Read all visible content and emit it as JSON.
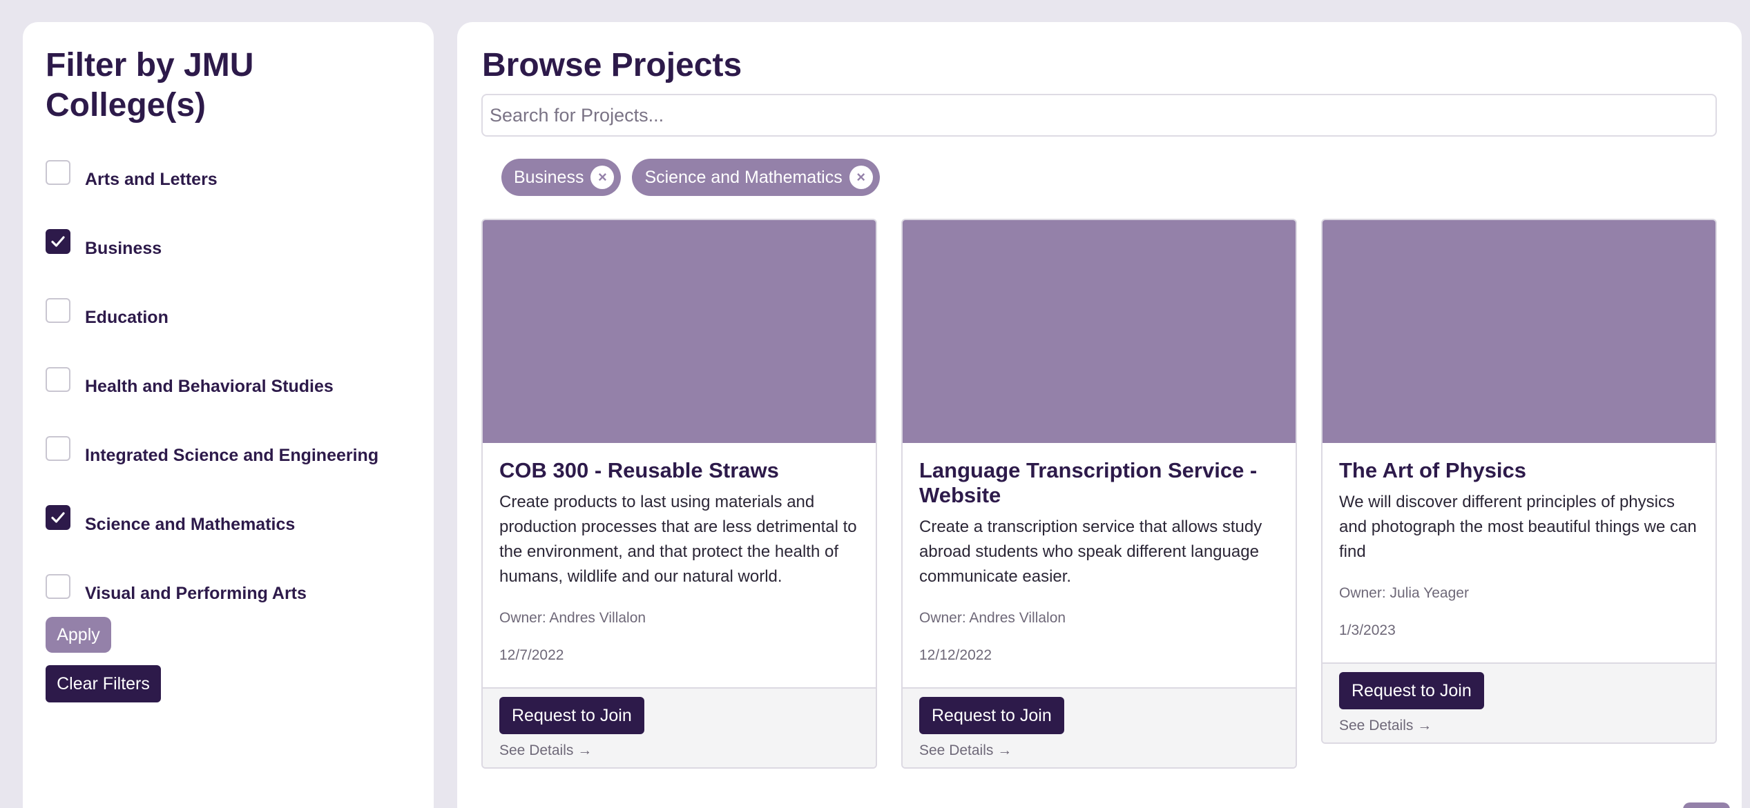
{
  "sidebar": {
    "title": "Filter by JMU College(s)",
    "items": [
      {
        "label": "Arts and Letters",
        "checked": false
      },
      {
        "label": "Business",
        "checked": true
      },
      {
        "label": "Education",
        "checked": false
      },
      {
        "label": "Health and Behavioral Studies",
        "checked": false
      },
      {
        "label": "Integrated Science and Engineering",
        "checked": false
      },
      {
        "label": "Science and Mathematics",
        "checked": true
      },
      {
        "label": "Visual and Performing Arts",
        "checked": false
      }
    ],
    "apply_label": "Apply",
    "clear_label": "Clear Filters"
  },
  "main": {
    "title": "Browse Projects",
    "search_placeholder": "Search for Projects...",
    "chips": [
      {
        "label": "Business",
        "remove_glyph": "×"
      },
      {
        "label": "Science and Mathematics",
        "remove_glyph": "×"
      }
    ],
    "cards": [
      {
        "title": "COB 300 - Reusable Straws",
        "description": "Create products to last using materials and production processes that are less detrimental to the environment, and that protect the health of humans, wildlife and our natural world.",
        "owner": "Owner: Andres Villalon",
        "date": "12/7/2022",
        "join_label": "Request to Join",
        "details_label": "See Details →"
      },
      {
        "title": "Language Transcription Service - Website",
        "description": "Create a transcription service that allows study abroad students who speak different language communicate easier.",
        "owner": "Owner: Andres Villalon",
        "date": "12/12/2022",
        "join_label": "Request to Join",
        "details_label": "See Details →"
      },
      {
        "title": "The Art of Physics",
        "description": "We will discover different principles of physics and photograph the most beautiful things we can find",
        "owner": "Owner: Julia Yeager",
        "date": "1/3/2023",
        "join_label": "Request to Join",
        "details_label": "See Details →"
      }
    ]
  },
  "colors": {
    "brand_dark": "#2d1a4a",
    "brand_light": "#9481a9",
    "background": "#e8e6ee"
  }
}
